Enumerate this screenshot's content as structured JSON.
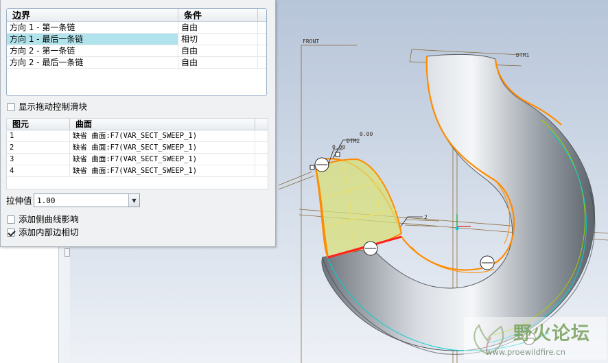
{
  "boundary_table": {
    "headers": [
      "边界",
      "条件"
    ],
    "rows": [
      {
        "boundary": "方向 1 - 第一条链",
        "condition": "自由"
      },
      {
        "boundary": "方向 1 - 最后一条链",
        "condition": "相切"
      },
      {
        "boundary": "方向 2 - 第一条链",
        "condition": "自由"
      },
      {
        "boundary": "方向 2 - 最后一条链",
        "condition": "自由"
      }
    ],
    "selected_row": 1
  },
  "show_drag_handles": {
    "label": "显示拖动控制滑块",
    "checked": false
  },
  "surface_table": {
    "headers": [
      "图元",
      "曲面"
    ],
    "rows": [
      {
        "element": "1",
        "surface": "缺省 曲面:F7(VAR_SECT_SWEEP_1)"
      },
      {
        "element": "2",
        "surface": "缺省 曲面:F7(VAR_SECT_SWEEP_1)"
      },
      {
        "element": "3",
        "surface": "缺省 曲面:F7(VAR_SECT_SWEEP_1)"
      },
      {
        "element": "4",
        "surface": "缺省 曲面:F7(VAR_SECT_SWEEP_1)"
      }
    ]
  },
  "stretch": {
    "label": "拉伸值",
    "value": "1.00"
  },
  "add_side_curve": {
    "label": "添加侧曲线影响",
    "checked": false
  },
  "add_inner_tangent": {
    "label": "添加内部边相切",
    "checked": true
  },
  "viewport": {
    "datum_labels": [
      "FRONT",
      "DTM1",
      "DTM2"
    ],
    "annotations": [
      "0.00",
      "0.00",
      "2"
    ],
    "colors": {
      "background": "#c9d4e3",
      "boundary_edge": "#ff8c00",
      "highlight_edge": "#ff2020",
      "tangent_edge": "#00d0d0",
      "preview_surface": "#d8df7a",
      "datum_plane": "#8a6a3a"
    }
  },
  "watermark": {
    "title": "野火论坛",
    "url": "www.proewildfire.cn"
  }
}
